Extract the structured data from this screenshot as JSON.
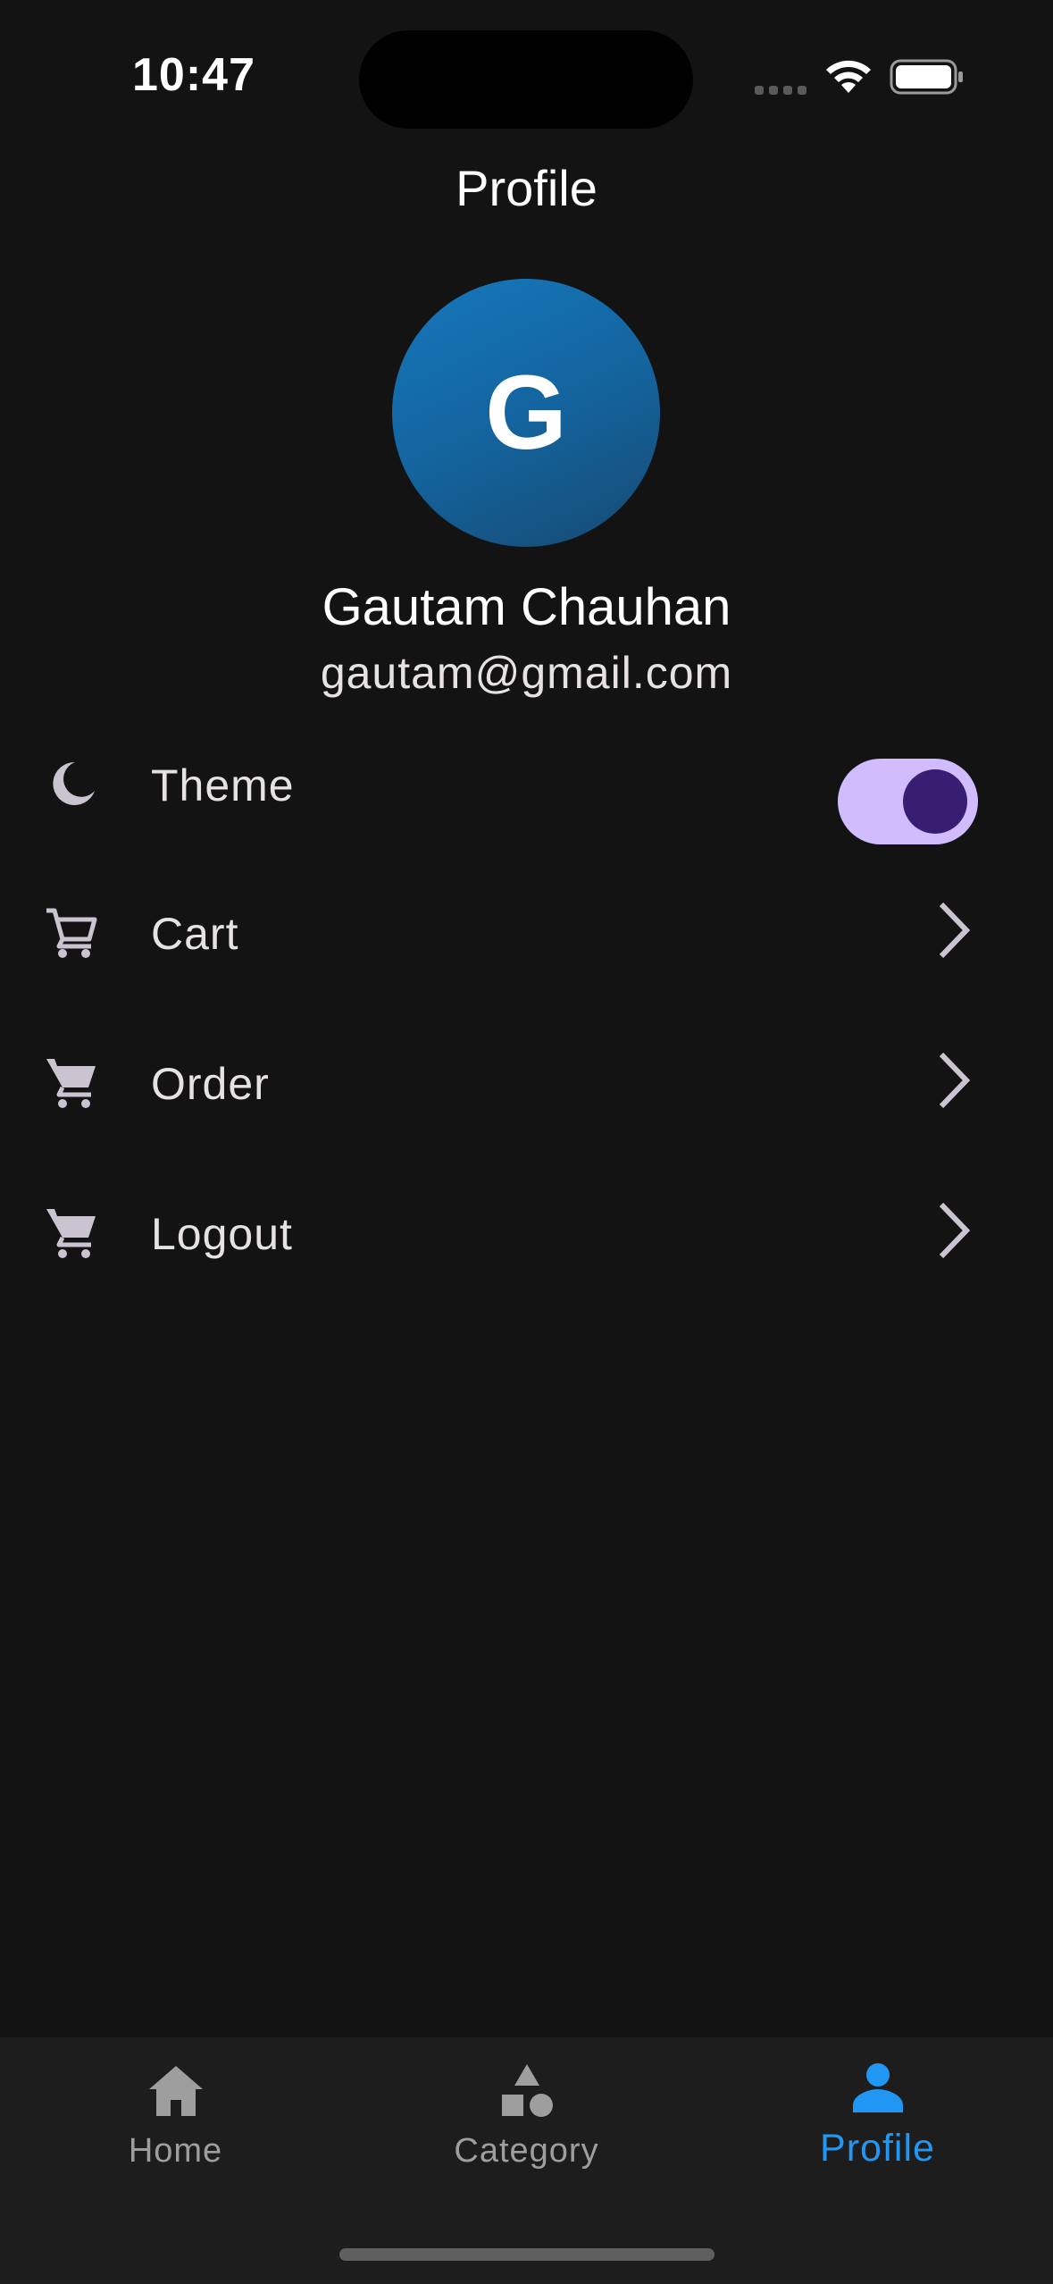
{
  "status_bar": {
    "time": "10:47",
    "icons": [
      "signal-icon",
      "wifi-icon",
      "battery-icon"
    ]
  },
  "header": {
    "title": "Profile"
  },
  "profile": {
    "avatar_letter": "G",
    "name": "Gautam Chauhan",
    "email": "gautam@gmail.com"
  },
  "menu": {
    "theme": {
      "label": "Theme",
      "icon": "moon-icon",
      "toggle_on": true
    },
    "cart": {
      "label": "Cart",
      "icon": "cart-outline-icon"
    },
    "order": {
      "label": "Order",
      "icon": "cart-icon"
    },
    "logout": {
      "label": "Logout",
      "icon": "cart-icon"
    }
  },
  "bottom_nav": {
    "items": [
      {
        "label": "Home",
        "icon": "home-icon",
        "active": false
      },
      {
        "label": "Category",
        "icon": "category-icon",
        "active": false
      },
      {
        "label": "Profile",
        "icon": "person-icon",
        "active": true
      }
    ]
  },
  "colors": {
    "background": "#131313",
    "nav_background": "#1d1d1d",
    "accent": "#2196f3",
    "toggle_track": "#d0bcff",
    "toggle_knob": "#381e72",
    "avatar": "#1570b0"
  }
}
